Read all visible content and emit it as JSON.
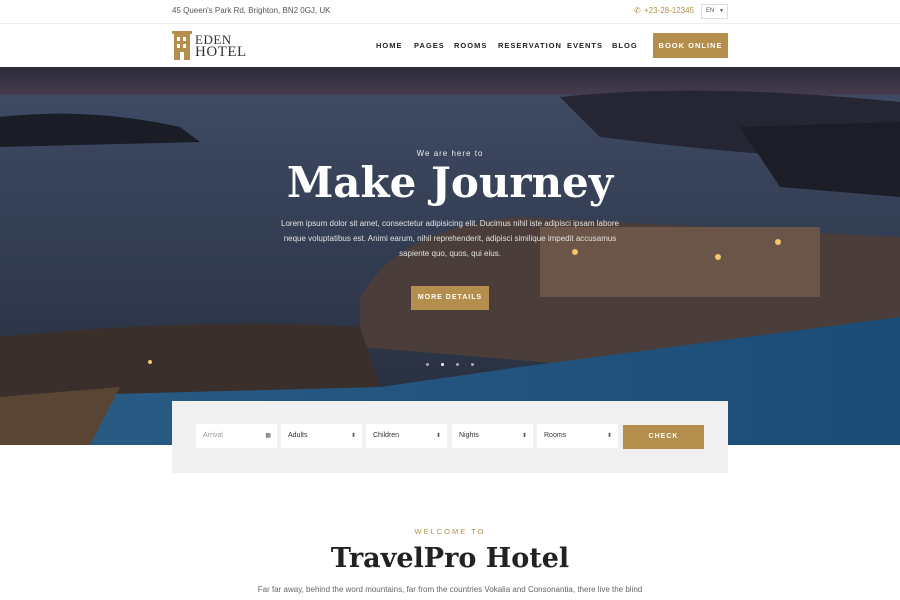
{
  "topbar": {
    "address": "45 Queen's Park Rd, Brighton, BN2 0GJ, UK",
    "phone": "+23-28-12345",
    "language": "EN"
  },
  "header": {
    "logo_line1": "EDEN",
    "logo_line2": "HOTEL",
    "nav": [
      "HOME",
      "PAGES",
      "ROOMS",
      "RESERVATION",
      "EVENTS",
      "BLOG"
    ],
    "book_label": "BOOK ONLINE"
  },
  "hero": {
    "subtitle": "We are here to",
    "title": "Make Journey",
    "text": "Lorem ipsum dolor sit amet, consectetur adipisicing elit. Ducimus nihil iste adipisci ipsam labore neque voluptatibus est. Animi earum, nihil reprehenderit, adipisci similique impedit accusamus sapiente quo, quos, qui eius.",
    "button": "MORE DETAILS",
    "slides": 4,
    "active_slide": 2
  },
  "booking": {
    "arrival_placeholder": "Arrival",
    "adults": "Adults",
    "children": "Children",
    "nights": "Nights",
    "rooms": "Rooms",
    "check_label": "CHECK"
  },
  "welcome": {
    "kicker": "WELCOME TO",
    "title": "TravelPro Hotel",
    "text": "Far far away, behind the word mountains, far from the countries Vokalia and Consonantia, there live the blind"
  },
  "colors": {
    "accent": "#b48e4c",
    "dark": "#222222"
  }
}
